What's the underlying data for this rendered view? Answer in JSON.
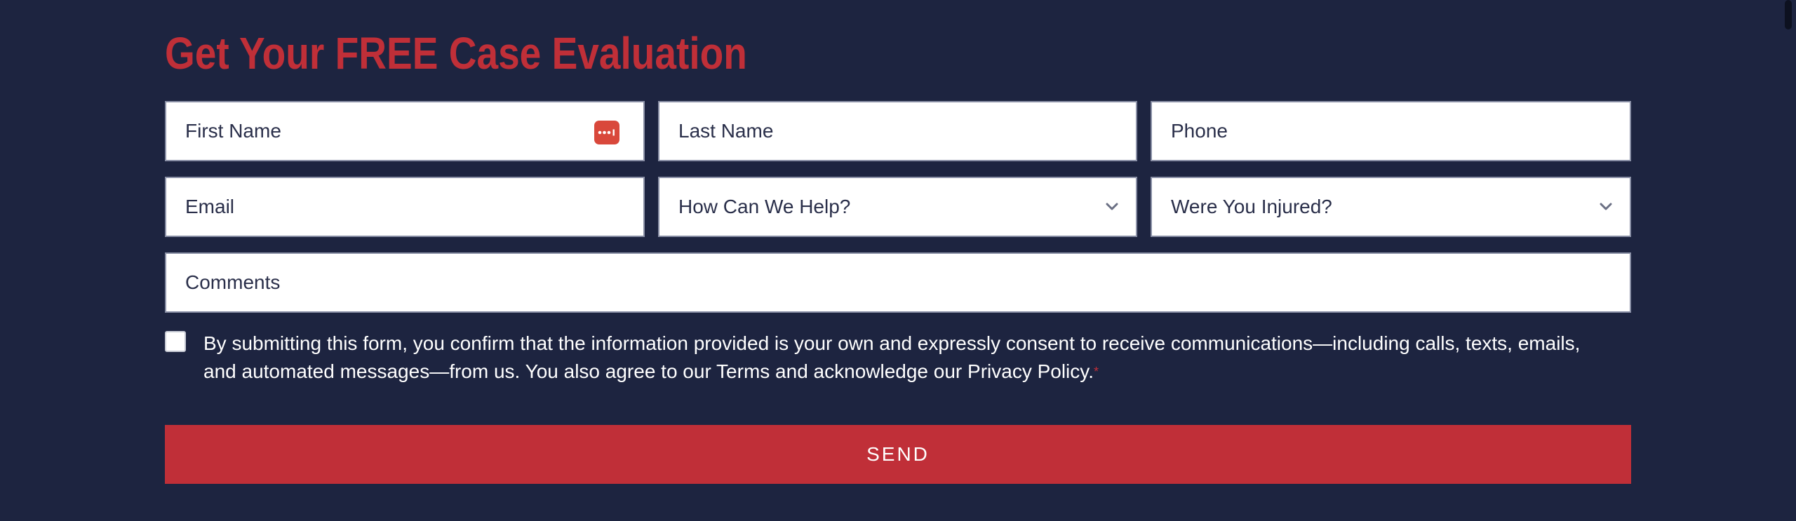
{
  "title": "Get Your FREE Case Evaluation",
  "fields": {
    "first_name": {
      "placeholder": "First Name"
    },
    "last_name": {
      "placeholder": "Last Name"
    },
    "phone": {
      "placeholder": "Phone"
    },
    "email": {
      "placeholder": "Email"
    },
    "help": {
      "selected": "How Can We Help?"
    },
    "injured": {
      "selected": "Were You Injured?"
    },
    "comments": {
      "placeholder": "Comments"
    }
  },
  "consent": {
    "text": "By submitting this form, you confirm that the information provided is your own and expressly consent to receive communications—including calls, texts, emails, and automated messages—from us. You also agree to our Terms and acknowledge our Privacy Policy.",
    "required_mark": "*",
    "checked": false
  },
  "send_label": "SEND",
  "icons": {
    "password_manager": "password-manager-icon",
    "dropdown": "chevron-down-icon"
  },
  "colors": {
    "background": "#1d2440",
    "accent": "#c02f38",
    "field_border": "#8a90a6"
  }
}
